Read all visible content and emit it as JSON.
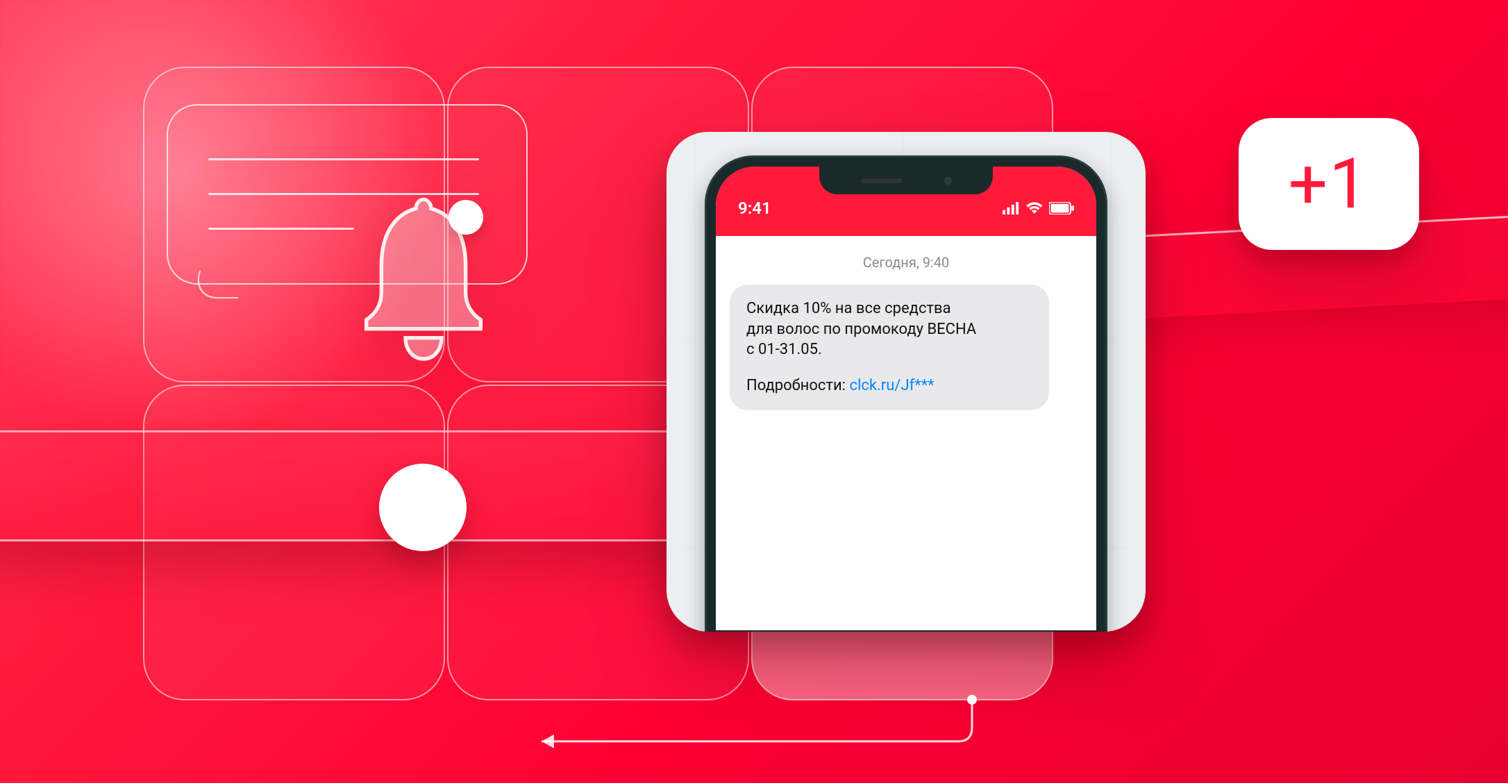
{
  "phone": {
    "time": "9:41",
    "sms_date": "Сегодня, 9:40",
    "sms_text_line1": "Скидка 10% на все средства",
    "sms_text_line2": "для волос по промокоду ВЕСНА",
    "sms_text_line3": "с 01-31.05.",
    "sms_details_label": "Подробности: ",
    "sms_link": "clck.ru/Jf***"
  },
  "badge": {
    "text": "+1"
  },
  "icons": {
    "bell": "bell-icon",
    "chat": "chat-bubble-icon",
    "signal": "signal-icon",
    "wifi": "wifi-icon",
    "battery": "battery-icon"
  },
  "colors": {
    "accent": "#ff1a3c",
    "link": "#0b84ff"
  }
}
